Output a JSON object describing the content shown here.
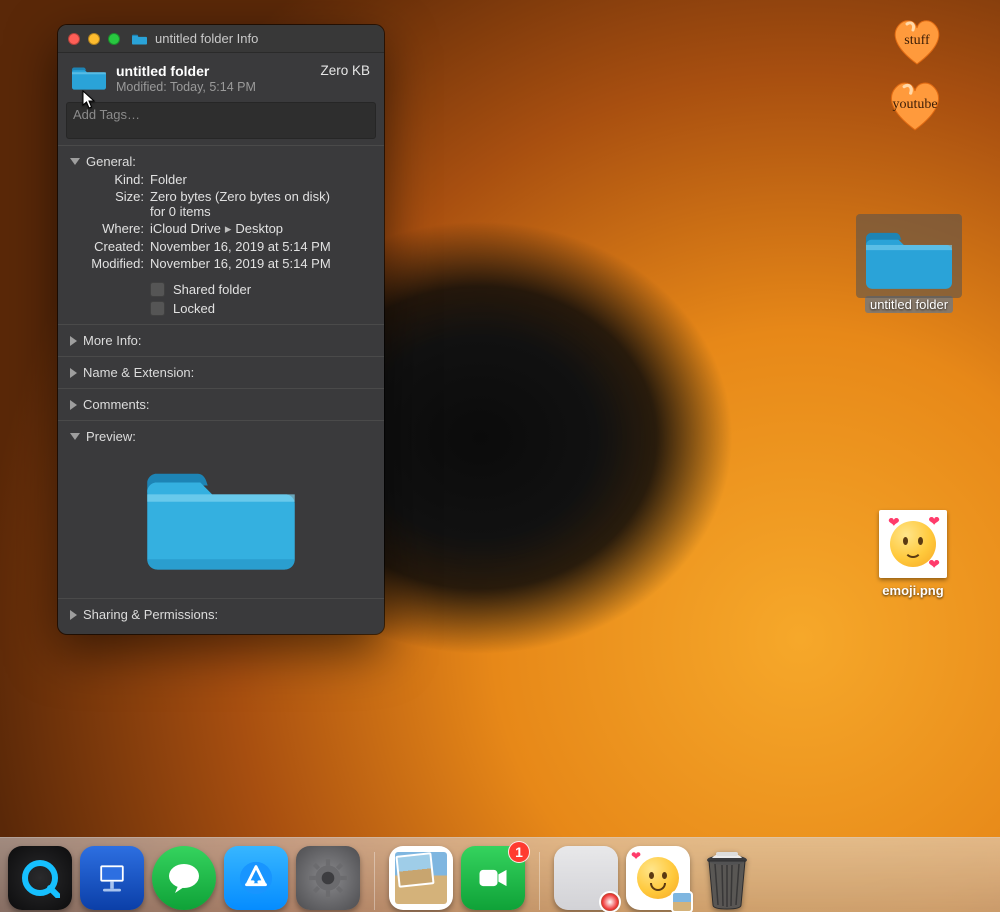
{
  "window": {
    "title": "untitled folder Info",
    "name": "untitled folder",
    "modified_line": "Modified: Today, 5:14 PM",
    "size_header": "Zero KB",
    "tags_placeholder": "Add Tags…",
    "sections": {
      "general": {
        "label": "General:",
        "kind_label": "Kind:",
        "kind_value": "Folder",
        "size_label": "Size:",
        "size_value_line1": "Zero bytes (Zero bytes on disk)",
        "size_value_line2": "for 0 items",
        "where_label": "Where:",
        "where_value_a": "iCloud Drive",
        "where_value_b": "Desktop",
        "created_label": "Created:",
        "created_value": "November 16, 2019 at 5:14 PM",
        "modified_label": "Modified:",
        "modified_value": "November 16, 2019 at 5:14 PM",
        "shared_label": "Shared folder",
        "locked_label": "Locked"
      },
      "more_info": "More Info:",
      "name_ext": "Name & Extension:",
      "comments": "Comments:",
      "preview": "Preview:",
      "sharing": "Sharing & Permissions:"
    }
  },
  "desktop": {
    "heart1": "stuff",
    "heart2": "youtube",
    "folder_label": "untitled folder",
    "file_label": "emoji.png"
  },
  "dock": {
    "badge_facetime": "1"
  }
}
